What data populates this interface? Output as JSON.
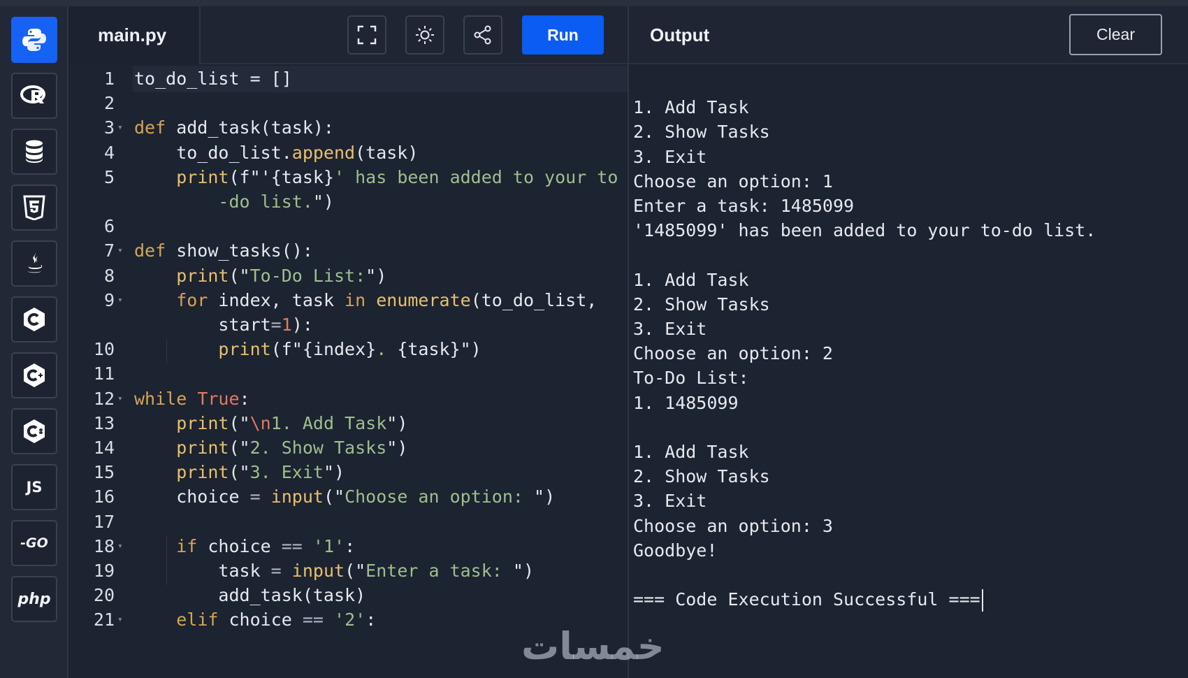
{
  "app": {
    "accent": "#1662f4",
    "background": "#1c2331"
  },
  "sidebar": {
    "languages": [
      {
        "id": "python",
        "icon": "python-icon",
        "active": true
      },
      {
        "id": "r",
        "icon": "r-icon",
        "active": false
      },
      {
        "id": "sql",
        "icon": "database-icon",
        "active": false
      },
      {
        "id": "html",
        "icon": "html5-icon",
        "active": false
      },
      {
        "id": "java",
        "icon": "java-icon",
        "active": false
      },
      {
        "id": "c",
        "icon": "c-icon",
        "active": false
      },
      {
        "id": "cpp",
        "icon": "cpp-icon",
        "active": false
      },
      {
        "id": "csharp",
        "icon": "csharp-icon",
        "active": false
      },
      {
        "id": "js",
        "icon": "js-icon",
        "label": "JS",
        "active": false
      },
      {
        "id": "go",
        "icon": "go-icon",
        "label": "-GO",
        "active": false
      },
      {
        "id": "php",
        "icon": "php-icon",
        "label": "php",
        "active": false
      }
    ]
  },
  "header": {
    "file_tab": "main.py",
    "tools": [
      "fullscreen-icon",
      "theme-toggle-icon",
      "share-icon"
    ],
    "run_label": "Run",
    "output_title": "Output",
    "clear_label": "Clear"
  },
  "editor": {
    "lines": [
      {
        "n": "1",
        "fold": false
      },
      {
        "n": "2",
        "fold": false
      },
      {
        "n": "3",
        "fold": true
      },
      {
        "n": "4",
        "fold": false
      },
      {
        "n": "5",
        "fold": false
      },
      {
        "n": "",
        "fold": false
      },
      {
        "n": "6",
        "fold": false
      },
      {
        "n": "7",
        "fold": true
      },
      {
        "n": "8",
        "fold": false
      },
      {
        "n": "9",
        "fold": true
      },
      {
        "n": "",
        "fold": false
      },
      {
        "n": "10",
        "fold": false
      },
      {
        "n": "11",
        "fold": false
      },
      {
        "n": "12",
        "fold": true
      },
      {
        "n": "13",
        "fold": false
      },
      {
        "n": "14",
        "fold": false
      },
      {
        "n": "15",
        "fold": false
      },
      {
        "n": "16",
        "fold": false
      },
      {
        "n": "17",
        "fold": false
      },
      {
        "n": "18",
        "fold": true
      },
      {
        "n": "19",
        "fold": false
      },
      {
        "n": "20",
        "fold": false
      },
      {
        "n": "21",
        "fold": true
      }
    ],
    "code": [
      [
        [
          "to_do_list = []",
          ""
        ]
      ],
      [],
      [
        [
          "def",
          "kw"
        ],
        [
          " add_task(task):",
          ""
        ]
      ],
      [
        [
          "    to_do_list.",
          ""
        ],
        [
          "append",
          "fn"
        ],
        [
          "(task)",
          ""
        ]
      ],
      [
        [
          "    ",
          ""
        ],
        [
          "print",
          "fn"
        ],
        [
          "(f\"'",
          ""
        ],
        [
          "{task}",
          ""
        ],
        [
          "' has been added to your to",
          "st"
        ]
      ],
      [
        [
          "        -do list.",
          "st"
        ],
        [
          "\")",
          ""
        ]
      ],
      [],
      [
        [
          "def",
          "kw"
        ],
        [
          " show_tasks():",
          ""
        ]
      ],
      [
        [
          "    ",
          ""
        ],
        [
          "print",
          "fn"
        ],
        [
          "(\"",
          ""
        ],
        [
          "To-Do List:",
          "st"
        ],
        [
          "\")",
          ""
        ]
      ],
      [
        [
          "    ",
          ""
        ],
        [
          "for",
          "kw"
        ],
        [
          " index, task ",
          ""
        ],
        [
          "in",
          "kw"
        ],
        [
          " ",
          ""
        ],
        [
          "enumerate",
          "fn"
        ],
        [
          "(to_do_list,",
          ""
        ]
      ],
      [
        [
          "        start",
          ""
        ],
        [
          "=",
          "op"
        ],
        [
          "1",
          "nm"
        ],
        [
          "):",
          ""
        ]
      ],
      [
        [
          "        ",
          ""
        ],
        [
          "print",
          "fn"
        ],
        [
          "(f\"{index}",
          ""
        ],
        [
          ". ",
          "st"
        ],
        [
          "{task}\")",
          ""
        ]
      ],
      [],
      [
        [
          "while",
          "kw"
        ],
        [
          " ",
          ""
        ],
        [
          "True",
          "nm"
        ],
        [
          ":",
          ""
        ]
      ],
      [
        [
          "    ",
          ""
        ],
        [
          "print",
          "fn"
        ],
        [
          "(\"",
          ""
        ],
        [
          "\\n",
          "nm"
        ],
        [
          "1. Add Task",
          "st"
        ],
        [
          "\")",
          ""
        ]
      ],
      [
        [
          "    ",
          ""
        ],
        [
          "print",
          "fn"
        ],
        [
          "(\"",
          ""
        ],
        [
          "2. Show Tasks",
          "st"
        ],
        [
          "\")",
          ""
        ]
      ],
      [
        [
          "    ",
          ""
        ],
        [
          "print",
          "fn"
        ],
        [
          "(\"",
          ""
        ],
        [
          "3. Exit",
          "st"
        ],
        [
          "\")",
          ""
        ]
      ],
      [
        [
          "    choice ",
          ""
        ],
        [
          "=",
          "op"
        ],
        [
          " ",
          ""
        ],
        [
          "input",
          "fn"
        ],
        [
          "(\"",
          ""
        ],
        [
          "Choose an option: ",
          "st"
        ],
        [
          "\")",
          ""
        ]
      ],
      [],
      [
        [
          "    ",
          ""
        ],
        [
          "if",
          "kw"
        ],
        [
          " choice ",
          ""
        ],
        [
          "==",
          "op"
        ],
        [
          " ",
          ""
        ],
        [
          "'1'",
          "st"
        ],
        [
          ":",
          ""
        ]
      ],
      [
        [
          "        task ",
          ""
        ],
        [
          "=",
          "op"
        ],
        [
          " ",
          ""
        ],
        [
          "input",
          "fn"
        ],
        [
          "(\"",
          ""
        ],
        [
          "Enter a task: ",
          "st"
        ],
        [
          "\")",
          ""
        ]
      ],
      [
        [
          "        add_task(task)",
          ""
        ]
      ],
      [
        [
          "    ",
          ""
        ],
        [
          "elif",
          "kw"
        ],
        [
          " choice ",
          ""
        ],
        [
          "==",
          "op"
        ],
        [
          " ",
          ""
        ],
        [
          "'2'",
          "st"
        ],
        [
          ":",
          ""
        ]
      ]
    ]
  },
  "output": {
    "lines": [
      "",
      "1. Add Task",
      "2. Show Tasks",
      "3. Exit",
      "Choose an option: 1",
      "Enter a task: 1485099",
      "'1485099' has been added to your to-do list.",
      "",
      "1. Add Task",
      "2. Show Tasks",
      "3. Exit",
      "Choose an option: 2",
      "To-Do List:",
      "1. 1485099",
      "",
      "1. Add Task",
      "2. Show Tasks",
      "3. Exit",
      "Choose an option: 3",
      "Goodbye!",
      "",
      "=== Code Execution Successful ==="
    ]
  },
  "watermark": "خمسات"
}
